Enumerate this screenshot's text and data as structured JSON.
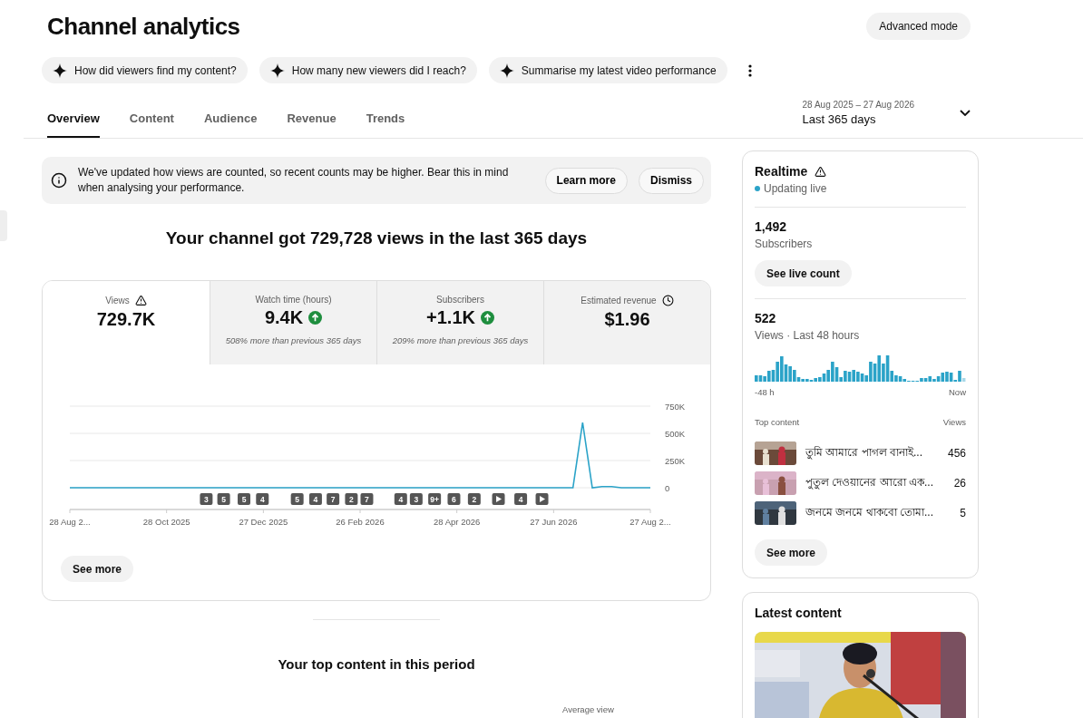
{
  "page": {
    "title": "Channel analytics",
    "advanced_button": "Advanced mode"
  },
  "prompts": [
    "How did viewers find my content?",
    "How many new viewers did I reach?",
    "Summarise my latest video performance"
  ],
  "tabs": [
    {
      "label": "Overview",
      "selected": true
    },
    {
      "label": "Content",
      "selected": false
    },
    {
      "label": "Audience",
      "selected": false
    },
    {
      "label": "Revenue",
      "selected": false
    },
    {
      "label": "Trends",
      "selected": false
    }
  ],
  "date_range": {
    "range": "28 Aug 2025 – 27 Aug 2026",
    "label": "Last 365 days"
  },
  "notice": {
    "text": "We've updated how views are counted, so recent counts may be higher. Bear this in mind when analysing your performance.",
    "buttons": [
      "Learn more",
      "Dismiss"
    ]
  },
  "headline": "Your channel got 729,728 views in the last 365 days",
  "metrics": [
    {
      "label": "Views",
      "value": "729.7K",
      "kind": "warning",
      "selected": true
    },
    {
      "label": "Watch time (hours)",
      "value": "9.4K",
      "kind": "growth",
      "comparison": "508% more than previous 365 days",
      "selected": false
    },
    {
      "label": "Subscribers",
      "value": "+1.1K",
      "kind": "growth",
      "comparison": "209% more than previous 365 days",
      "selected": false
    },
    {
      "label": "Estimated revenue",
      "value": "$1.96",
      "kind": "pending",
      "selected": false
    }
  ],
  "chart_data": {
    "type": "line",
    "ylim": [
      0,
      750000
    ],
    "yticks": [
      {
        "value": 0,
        "label": "0"
      },
      {
        "value": 250000,
        "label": "250K"
      },
      {
        "value": 500000,
        "label": "500K"
      },
      {
        "value": 750000,
        "label": "750K"
      }
    ],
    "categories": [
      "28 Aug 2...",
      null,
      null,
      null,
      null,
      null,
      null,
      null,
      null,
      null,
      "28 Oct 2025",
      null,
      null,
      null,
      null,
      null,
      null,
      null,
      null,
      null,
      "27 Dec 2025",
      null,
      null,
      null,
      null,
      null,
      null,
      null,
      null,
      null,
      "26 Feb 2026",
      null,
      null,
      null,
      null,
      null,
      null,
      null,
      null,
      null,
      "28 Apr 2026",
      null,
      null,
      null,
      null,
      null,
      null,
      null,
      null,
      null,
      "27 Jun 2026",
      null,
      null,
      null,
      null,
      null,
      null,
      null,
      null,
      null,
      "27 Aug 2..."
    ],
    "series": [
      {
        "color": "#2ba3c8",
        "values": [
          0,
          0,
          0,
          0,
          0,
          0,
          0,
          0,
          0,
          0,
          0,
          0,
          0,
          0,
          0,
          0,
          0,
          0,
          0,
          0,
          0,
          0,
          0,
          0,
          0,
          0,
          0,
          0,
          0,
          0,
          0,
          0,
          0,
          0,
          0,
          0,
          0,
          0,
          0,
          0,
          0,
          0,
          0,
          0,
          0,
          0,
          0,
          0,
          0,
          0,
          0,
          0,
          0,
          600000,
          0,
          10000,
          10000,
          0,
          0,
          0,
          0
        ]
      }
    ]
  },
  "chart_events": [
    {
      "kind": "count",
      "label": "3"
    },
    {
      "kind": "count",
      "label": "5"
    },
    {
      "kind": "count",
      "label": "5"
    },
    {
      "kind": "count",
      "label": "4"
    },
    {
      "kind": "count",
      "label": "5"
    },
    {
      "kind": "count",
      "label": "4"
    },
    {
      "kind": "count",
      "label": "7"
    },
    {
      "kind": "count",
      "label": "2"
    },
    {
      "kind": "count",
      "label": "7"
    },
    {
      "kind": "count",
      "label": "4"
    },
    {
      "kind": "count",
      "label": "3"
    },
    {
      "kind": "count",
      "label": "9+"
    },
    {
      "kind": "count",
      "label": "6"
    },
    {
      "kind": "count",
      "label": "2"
    },
    {
      "kind": "video"
    },
    {
      "kind": "count",
      "label": "4"
    },
    {
      "kind": "video"
    }
  ],
  "see_more": "See more",
  "top_content": {
    "title": "Your top content in this period",
    "columns": [
      "Average view"
    ]
  },
  "realtime": {
    "title": "Realtime",
    "status": "Updating live",
    "subscribers": {
      "value": "1,492",
      "label": "Subscribers",
      "button": "See live count"
    },
    "views": {
      "value": "522",
      "label": "Views · Last 48 hours"
    },
    "axis_start": "-48 h",
    "axis_end": "Now",
    "list_header": [
      "Top content",
      "Views"
    ],
    "items": [
      {
        "title": "তুমি আমারে পাগল বানাই...",
        "views": "456"
      },
      {
        "title": "পুতুল দেওয়ানের আরো এক...",
        "views": "26"
      },
      {
        "title": "জনমে জনমে থাকবো তোমা...",
        "views": "5"
      }
    ],
    "see_more": "See more"
  },
  "latest": {
    "title": "Latest content"
  }
}
